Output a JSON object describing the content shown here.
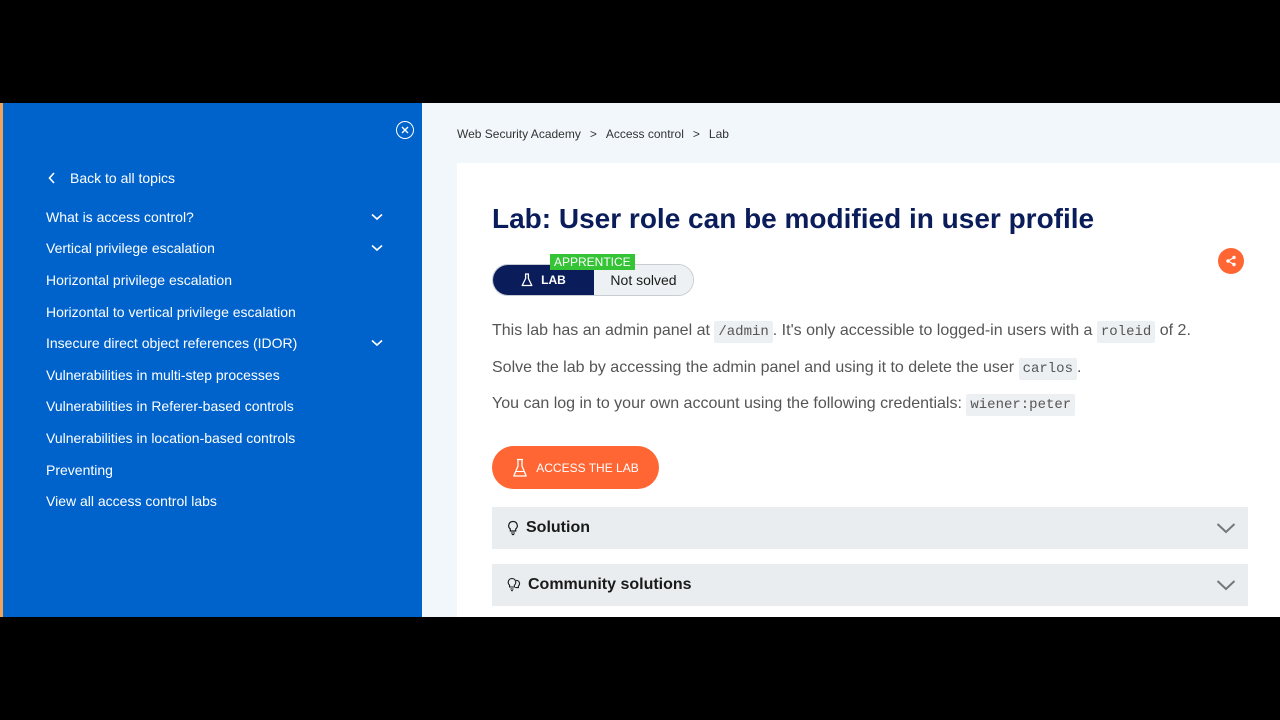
{
  "sidebar": {
    "back_label": "Back to all topics",
    "items": [
      {
        "label": "What is access control?",
        "expandable": true
      },
      {
        "label": "Vertical privilege escalation",
        "expandable": true
      },
      {
        "label": "Horizontal privilege escalation",
        "expandable": false
      },
      {
        "label": "Horizontal to vertical privilege escalation",
        "expandable": false
      },
      {
        "label": "Insecure direct object references (IDOR)",
        "expandable": true
      },
      {
        "label": "Vulnerabilities in multi-step processes",
        "expandable": false
      },
      {
        "label": "Vulnerabilities in Referer-based controls",
        "expandable": false
      },
      {
        "label": "Vulnerabilities in location-based controls",
        "expandable": false
      },
      {
        "label": "Preventing",
        "expandable": false
      },
      {
        "label": "View all access control labs",
        "expandable": false
      }
    ]
  },
  "breadcrumb": {
    "items": [
      "Web Security Academy",
      "Access control",
      "Lab"
    ],
    "separator": ">"
  },
  "lab": {
    "title": "Lab: User role can be modified in user profile",
    "level_badge": "APPRENTICE",
    "type_label": "LAB",
    "status": "Not solved",
    "p1": {
      "a": "This lab has an admin panel at ",
      "code1": "/admin",
      "b": ". It's only accessible to logged-in users with a ",
      "code2": "roleid",
      "c": " of 2."
    },
    "p2": {
      "a": "Solve the lab by accessing the admin panel and using it to delete the user ",
      "code1": "carlos",
      "b": "."
    },
    "p3": {
      "a": "You can log in to your own account using the following credentials: ",
      "code1": "wiener:peter"
    },
    "access_button": "ACCESS THE LAB"
  },
  "accordions": {
    "solution": "Solution",
    "community": "Community solutions"
  },
  "colors": {
    "sidebar_bg": "#0063cc",
    "title": "#0a1d5a",
    "accent": "#ff6633",
    "badge": "#35c435"
  },
  "icons": {
    "close": "close-icon",
    "back": "chevron-left-icon",
    "expand": "chevron-down-icon",
    "share": "share-icon",
    "flask": "flask-icon",
    "solution": "lightbulb-icon",
    "community": "lightbulbs-icon"
  }
}
